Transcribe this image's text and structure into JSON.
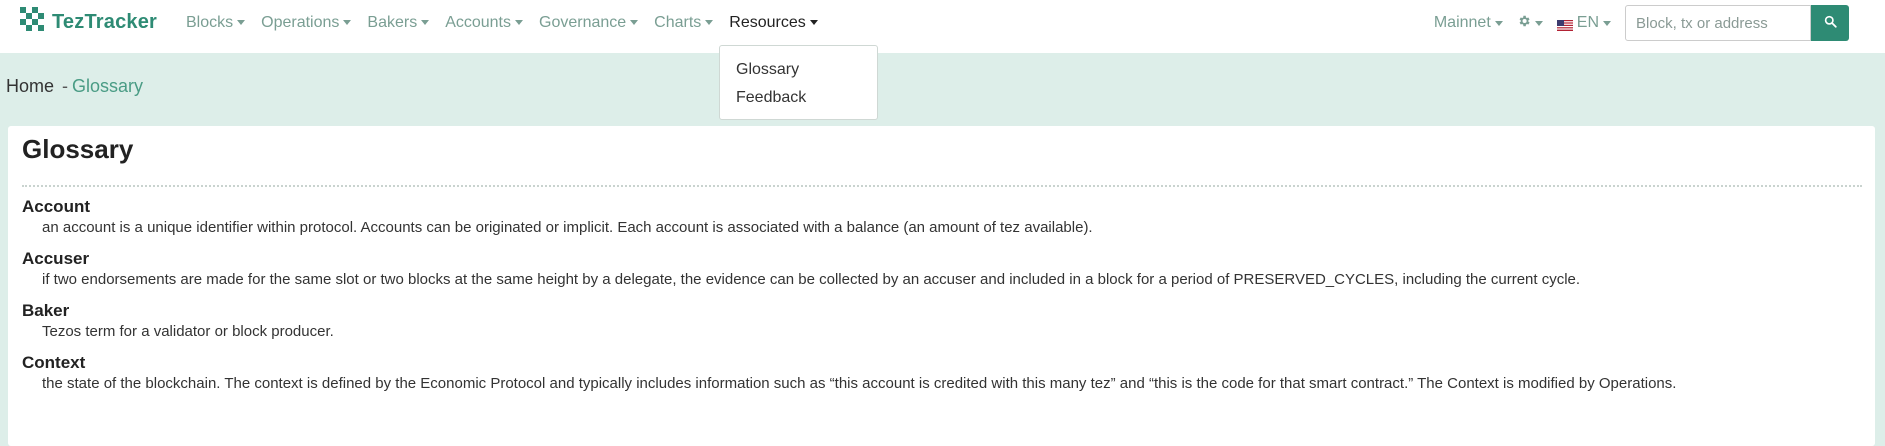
{
  "brand": {
    "name": "TezTracker",
    "logo_icon": "checker-logo-icon",
    "color": "#2e8b74"
  },
  "nav": [
    {
      "label": "Blocks",
      "active": false
    },
    {
      "label": "Operations",
      "active": false
    },
    {
      "label": "Bakers",
      "active": false
    },
    {
      "label": "Accounts",
      "active": false
    },
    {
      "label": "Governance",
      "active": false
    },
    {
      "label": "Charts",
      "active": false
    },
    {
      "label": "Resources",
      "active": true
    }
  ],
  "nav_right": {
    "network": "Mainnet",
    "settings_icon": "gear-icon",
    "language": "EN",
    "flag_icon": "us-flag-icon",
    "search_placeholder": "Block, tx or address",
    "search_value": ""
  },
  "resources_menu": {
    "items": [
      {
        "label": "Glossary"
      },
      {
        "label": "Feedback"
      }
    ]
  },
  "breadcrumb": {
    "home": "Home",
    "separator": "-",
    "current": "Glossary"
  },
  "page": {
    "title": "Glossary",
    "entries": [
      {
        "term": "Account",
        "definition": "an account is a unique identifier within protocol. Accounts can be originated or implicit. Each account is associated with a balance (an amount of tez available)."
      },
      {
        "term": "Accuser",
        "definition": "if two endorsements are made for the same slot or two blocks at the same height by a delegate, the evidence can be collected by an accuser and included in a block for a period of PRESERVED_CYCLES, including the current cycle."
      },
      {
        "term": "Baker",
        "definition": "Tezos term for a validator or block producer."
      },
      {
        "term": "Context",
        "definition": "the state of the blockchain. The context is defined by the Economic Protocol and typically includes information such as “this account is credited with this many tez” and “this is the code for that smart contract.” The Context is modified by Operations."
      }
    ]
  },
  "colors": {
    "accent": "#2e8b74",
    "muted_link": "#7a9e93",
    "background": "#ddeee9"
  }
}
